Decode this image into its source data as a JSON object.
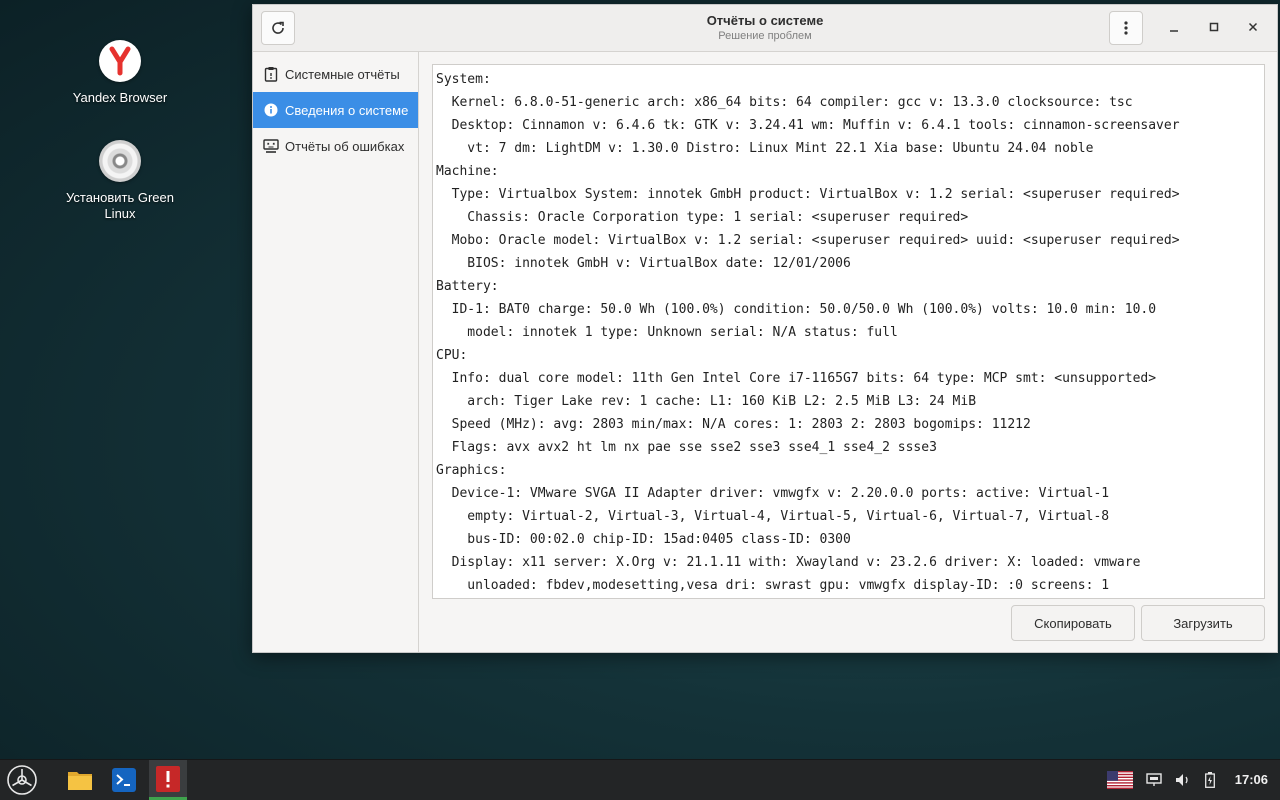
{
  "desktop": {
    "icons": [
      {
        "label": "Yandex Browser",
        "icon": "yandex-browser-icon"
      },
      {
        "label": "Установить Green Linux",
        "icon": "install-disc-icon"
      }
    ]
  },
  "window": {
    "title": "Отчёты о системе",
    "subtitle": "Решение проблем",
    "refresh_icon": "refresh-icon",
    "menu_icon": "kebab-menu-icon"
  },
  "sidebar": {
    "items": [
      {
        "label": "Системные отчёты",
        "icon": "clipboard-icon",
        "active": false
      },
      {
        "label": "Сведения о системе",
        "icon": "info-icon",
        "active": true
      },
      {
        "label": "Отчёты об ошибках",
        "icon": "crash-report-icon",
        "active": false
      }
    ]
  },
  "report": {
    "lines": [
      "System:",
      "  Kernel: 6.8.0-51-generic arch: x86_64 bits: 64 compiler: gcc v: 13.3.0 clocksource: tsc",
      "  Desktop: Cinnamon v: 6.4.6 tk: GTK v: 3.24.41 wm: Muffin v: 6.4.1 tools: cinnamon-screensaver",
      "    vt: 7 dm: LightDM v: 1.30.0 Distro: Linux Mint 22.1 Xia base: Ubuntu 24.04 noble",
      "Machine:",
      "  Type: Virtualbox System: innotek GmbH product: VirtualBox v: 1.2 serial: <superuser required>",
      "    Chassis: Oracle Corporation type: 1 serial: <superuser required>",
      "  Mobo: Oracle model: VirtualBox v: 1.2 serial: <superuser required> uuid: <superuser required>",
      "    BIOS: innotek GmbH v: VirtualBox date: 12/01/2006",
      "Battery:",
      "  ID-1: BAT0 charge: 50.0 Wh (100.0%) condition: 50.0/50.0 Wh (100.0%) volts: 10.0 min: 10.0",
      "    model: innotek 1 type: Unknown serial: N/A status: full",
      "CPU:",
      "  Info: dual core model: 11th Gen Intel Core i7-1165G7 bits: 64 type: MCP smt: <unsupported>",
      "    arch: Tiger Lake rev: 1 cache: L1: 160 KiB L2: 2.5 MiB L3: 24 MiB",
      "  Speed (MHz): avg: 2803 min/max: N/A cores: 1: 2803 2: 2803 bogomips: 11212",
      "  Flags: avx avx2 ht lm nx pae sse sse2 sse3 sse4_1 sse4_2 ssse3",
      "Graphics:",
      "  Device-1: VMware SVGA II Adapter driver: vmwgfx v: 2.20.0.0 ports: active: Virtual-1",
      "    empty: Virtual-2, Virtual-3, Virtual-4, Virtual-5, Virtual-6, Virtual-7, Virtual-8",
      "    bus-ID: 00:02.0 chip-ID: 15ad:0405 class-ID: 0300",
      "  Display: x11 server: X.Org v: 21.1.11 with: Xwayland v: 23.2.6 driver: X: loaded: vmware",
      "    unloaded: fbdev,modesetting,vesa dri: swrast gpu: vmwgfx display-ID: :0 screens: 1"
    ]
  },
  "buttons": {
    "copy": "Скопировать",
    "upload": "Загрузить"
  },
  "taskbar": {
    "apps": [
      {
        "icon": "menu-logo-icon"
      },
      {
        "icon": "folder-icon"
      },
      {
        "icon": "terminal-icon"
      },
      {
        "icon": "system-reports-icon",
        "active": true
      }
    ],
    "tray": [
      "us-flag-icon",
      "network-icon",
      "volume-icon",
      "battery-icon"
    ],
    "clock": "17:06"
  },
  "colors": {
    "accent": "#3b8ee6",
    "active_app_underline": "#3fa34d"
  }
}
